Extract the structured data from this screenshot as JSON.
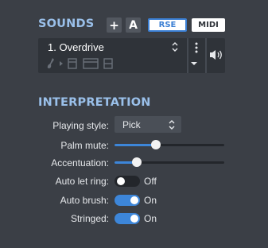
{
  "sounds": {
    "title": "SOUNDS",
    "add_label": "+",
    "auto_label": "A",
    "rse_label": "RSE",
    "midi_label": "MIDI",
    "selected_sound": "1. Overdrive",
    "icons": [
      "guitar-icon",
      "play-triangle-icon",
      "amp-icon",
      "effect-rack-icon",
      "amp-stack-icon"
    ]
  },
  "interpretation": {
    "title": "INTERPRETATION",
    "playing_style": {
      "label": "Playing style:",
      "value": "Pick"
    },
    "palm_mute": {
      "label": "Palm mute:",
      "value": 0.38
    },
    "accentuation": {
      "label": "Accentuation:",
      "value": 0.2
    },
    "auto_let_ring": {
      "label": "Auto let ring:",
      "state": "Off",
      "on": false
    },
    "auto_brush": {
      "label": "Auto brush:",
      "state": "On",
      "on": true
    },
    "stringed": {
      "label": "Stringed:",
      "state": "On",
      "on": true
    }
  },
  "colors": {
    "background": "#3b3f46",
    "accent": "#3d86d9",
    "section_title": "#9ac0ea"
  }
}
